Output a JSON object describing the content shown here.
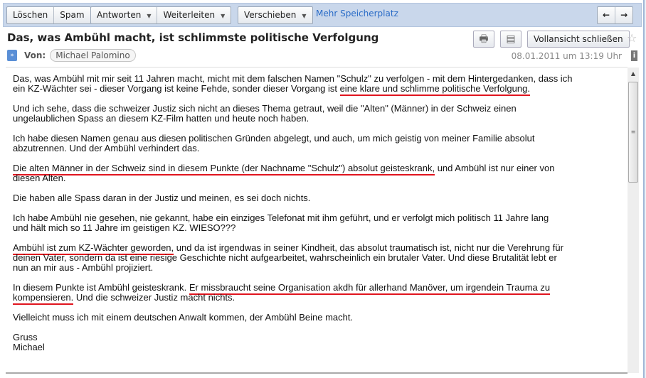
{
  "toolbar": {
    "delete": "Löschen",
    "spam": "Spam",
    "reply": "Antworten",
    "forward": "Weiterleiten",
    "move": "Verschieben",
    "more_storage": "Mehr Speicherplatz"
  },
  "message": {
    "subject": "Das, was Ambühl macht, ist schlimmste politische Verfolgung",
    "close_full_view": "Vollansicht schließen",
    "from_label": "Von:",
    "sender": "Michael Palomino",
    "date": "08.01.2011 um 13:19 Uhr",
    "highlight_color": "#e0141e",
    "paragraphs": [
      [
        [
          {
            "t": "Das, was Ambühl mit mir seit 11 Jahren macht, micht mit dem falschen Namen \"Schulz\" zu verfolgen - mit dem Hintergedanken, dass ich"
          }
        ],
        [
          {
            "t": "ein KZ-Wächter sei - dieser Vorgang ist keine Fehde, sonder dieser Vorgang ist "
          },
          {
            "t": "eine klare und schlimme politische Verfolgung.",
            "u": true
          }
        ]
      ],
      [
        [
          {
            "t": "Und ich sehe, dass die schweizer Justiz sich nicht an dieses Thema getraut, weil die \"Alten\" (Männer) in der Schweiz einen"
          }
        ],
        [
          {
            "t": "ungelaublichen Spass an diesem KZ-Film hatten und heute noch haben."
          }
        ]
      ],
      [
        [
          {
            "t": "Ich habe diesen Namen genau aus diesen politischen Gründen abgelegt, und auch, um mich geistig von meiner Familie absolut"
          }
        ],
        [
          {
            "t": "abzutrennen. Und der Ambühl verhindert das."
          }
        ]
      ],
      [
        [
          {
            "t": "Die alten Männer in der Schweiz sind in diesem Punkte (der Nachname \"Schulz\") absolut geisteskrank,",
            "u": true
          },
          {
            "t": " und Ambühl ist nur einer von"
          }
        ],
        [
          {
            "t": "diesen Alten."
          }
        ]
      ],
      [
        [
          {
            "t": "Die haben alle Spass daran in der Justiz und meinen, es sei doch nichts."
          }
        ]
      ],
      [
        [
          {
            "t": "Ich habe Ambühl nie gesehen, nie gekannt, habe ein einziges Telefonat mit ihm geführt, und er verfolgt mich politisch 11 Jahre lang"
          }
        ],
        [
          {
            "t": "und hält mich so 11 Jahre im geistigen KZ. WIESO???"
          }
        ]
      ],
      [
        [
          {
            "t": "Ambühl ist zum KZ-Wächter geworden,",
            "u": true
          },
          {
            "t": " und da ist irgendwas in seiner Kindheit, das absolut traumatisch ist, nicht nur die Verehrung für"
          }
        ],
        [
          {
            "t": "deinen Vater, sondern da ist eine riesige Geschichte nicht aufgearbeitet, wahrscheinlich ein brutaler Vater. Und diese Brutalität lebt er"
          }
        ],
        [
          {
            "t": "nun an mir aus - Ambühl projiziert."
          }
        ]
      ],
      [
        [
          {
            "t": "In diesem Punkte ist Ambühl geisteskrank. "
          },
          {
            "t": "Er missbraucht seine Organisation akdh für allerhand Manöver, um irgendein Trauma zu ",
            "u": true
          }
        ],
        [
          {
            "t": "kompensieren.",
            "u": true
          },
          {
            "t": " Und die schweizer Justiz macht nichts."
          }
        ]
      ],
      [
        [
          {
            "t": "Vielleicht muss ich mit einem deutschen Anwalt kommen, der Ambühl Beine macht."
          }
        ]
      ],
      [
        [
          {
            "t": "Gruss"
          }
        ],
        [
          {
            "t": "Michael"
          }
        ]
      ]
    ]
  }
}
